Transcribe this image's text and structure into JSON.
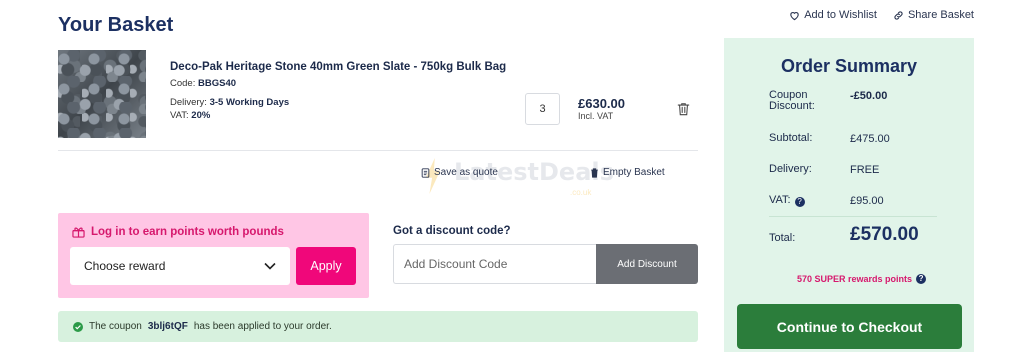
{
  "page": {
    "title": "Your Basket"
  },
  "actions": {
    "wishlist": "Add to Wishlist",
    "share": "Share Basket"
  },
  "product": {
    "name": "Deco-Pak Heritage Stone 40mm Green Slate - 750kg Bulk Bag",
    "code_label": "Code:",
    "code": "BBGS40",
    "delivery_label": "Delivery:",
    "delivery": "3-5 Working Days",
    "vat_label": "VAT:",
    "vat": "20%",
    "quantity": "3",
    "price": "£630.00",
    "price_note": "Incl. VAT"
  },
  "basket_links": {
    "save_quote": "Save as quote",
    "empty": "Empty Basket"
  },
  "watermark": {
    "text": "LatestDeals",
    "sub": ".co.uk"
  },
  "rewards": {
    "title": "Log in to earn points worth pounds",
    "select_value": "Choose reward",
    "apply_label": "Apply"
  },
  "discount": {
    "label": "Got a discount code?",
    "placeholder": "Add Discount Code",
    "button": "Add Discount"
  },
  "coupon": {
    "prefix": "The coupon",
    "code": "3blj6tQF",
    "suffix": "has been applied to your order."
  },
  "summary": {
    "title": "Order Summary",
    "coupon_label": "Coupon Discount:",
    "coupon_value": "-£50.00",
    "subtotal_label": "Subtotal:",
    "subtotal_value": "£475.00",
    "delivery_label": "Delivery:",
    "delivery_value": "FREE",
    "vat_label": "VAT:",
    "vat_value": "£95.00",
    "total_label": "Total:",
    "total_value": "£570.00",
    "points": "570 SUPER rewards points",
    "checkout_label": "Continue to Checkout"
  },
  "colors": {
    "brand_navy": "#1c3062",
    "pink_accent": "#f0077a",
    "checkout_green": "#2b7d3b",
    "summary_bg": "#e1f4e9",
    "rewards_bg": "#ffc6e5",
    "coupon_bg": "#d7f1de"
  },
  "icons": {
    "wishlist": "heart-icon",
    "share": "link-icon",
    "delete": "trash-icon",
    "save_quote": "document-icon",
    "empty_basket": "trash-icon",
    "rewards": "gift-icon",
    "select": "chevron-down-icon",
    "coupon": "check-circle-icon",
    "help": "help-icon"
  }
}
